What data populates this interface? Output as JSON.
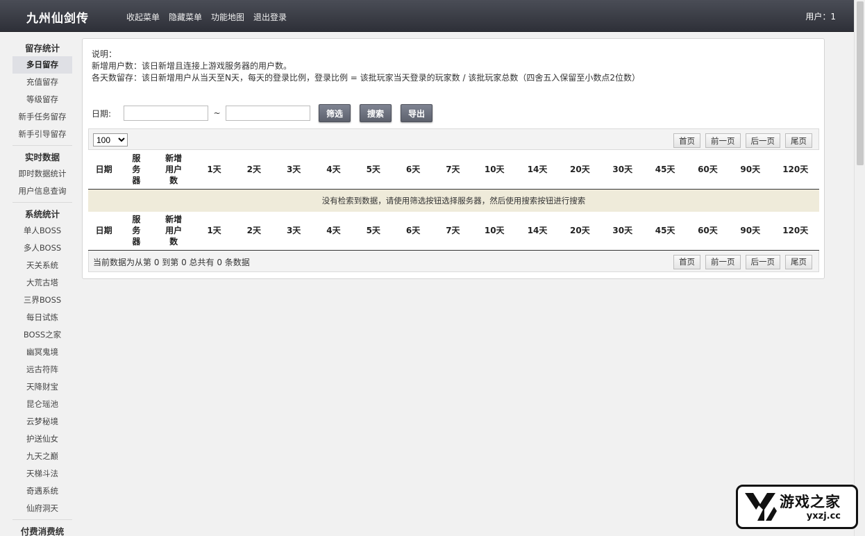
{
  "header": {
    "brand": "九州仙剑传",
    "nav": [
      "收起菜单",
      "隐藏菜单",
      "功能地图",
      "退出登录"
    ],
    "user": "用户：1"
  },
  "sidebar": {
    "sections": [
      {
        "title": "留存统计",
        "items": [
          "多日留存",
          "充值留存",
          "等级留存",
          "新手任务留存",
          "新手引导留存"
        ],
        "active": "多日留存"
      },
      {
        "title": "实时数据",
        "items": [
          "即时数据统计",
          "用户信息查询"
        ]
      },
      {
        "title": "系统统计",
        "items": [
          "单人BOSS",
          "多人BOSS",
          "天关系统",
          "大荒古塔",
          "三界BOSS",
          "每日试炼",
          "BOSS之家",
          "幽冥鬼境",
          "远古符阵",
          "天降财宝",
          "昆仑瑶池",
          "云梦秘境",
          "护送仙女",
          "九天之巅",
          "天梯斗法",
          "奇遇系统",
          "仙府洞天"
        ]
      },
      {
        "title": "付费消费统",
        "items": []
      }
    ]
  },
  "description": {
    "title": "说明：",
    "lines": [
      "新增用户数：该日新增且连接上游戏服务器的用户数。",
      "各天数留存：该日新增用户从当天至N天，每天的登录比例，登录比例 = 该批玩家当天登录的玩家数 / 该批玩家总数（四舍五入保留至小数点2位数）"
    ]
  },
  "filter": {
    "date_label": "日期:",
    "start_value": "",
    "end_value": "",
    "separator": "~",
    "buttons": {
      "filter": "筛选",
      "search": "搜索",
      "export": "导出"
    }
  },
  "table": {
    "page_size": "100",
    "page_size_options": [
      "100"
    ],
    "pager": [
      "首页",
      "前一页",
      "后一页",
      "尾页"
    ],
    "columns": [
      "日期",
      "服务器",
      "新增用户数",
      "1天",
      "2天",
      "3天",
      "4天",
      "5天",
      "6天",
      "7天",
      "10天",
      "14天",
      "20天",
      "30天",
      "45天",
      "60天",
      "90天",
      "120天"
    ],
    "empty_message": "没有检索到数据，请使用筛选按钮选择服务器，然后使用搜索按钮进行搜索",
    "summary": "当前数据为从第 0 到第 0 总共有 0 条数据"
  },
  "watermark": {
    "cn": "游戏之家",
    "en": "yxzj.cc"
  }
}
